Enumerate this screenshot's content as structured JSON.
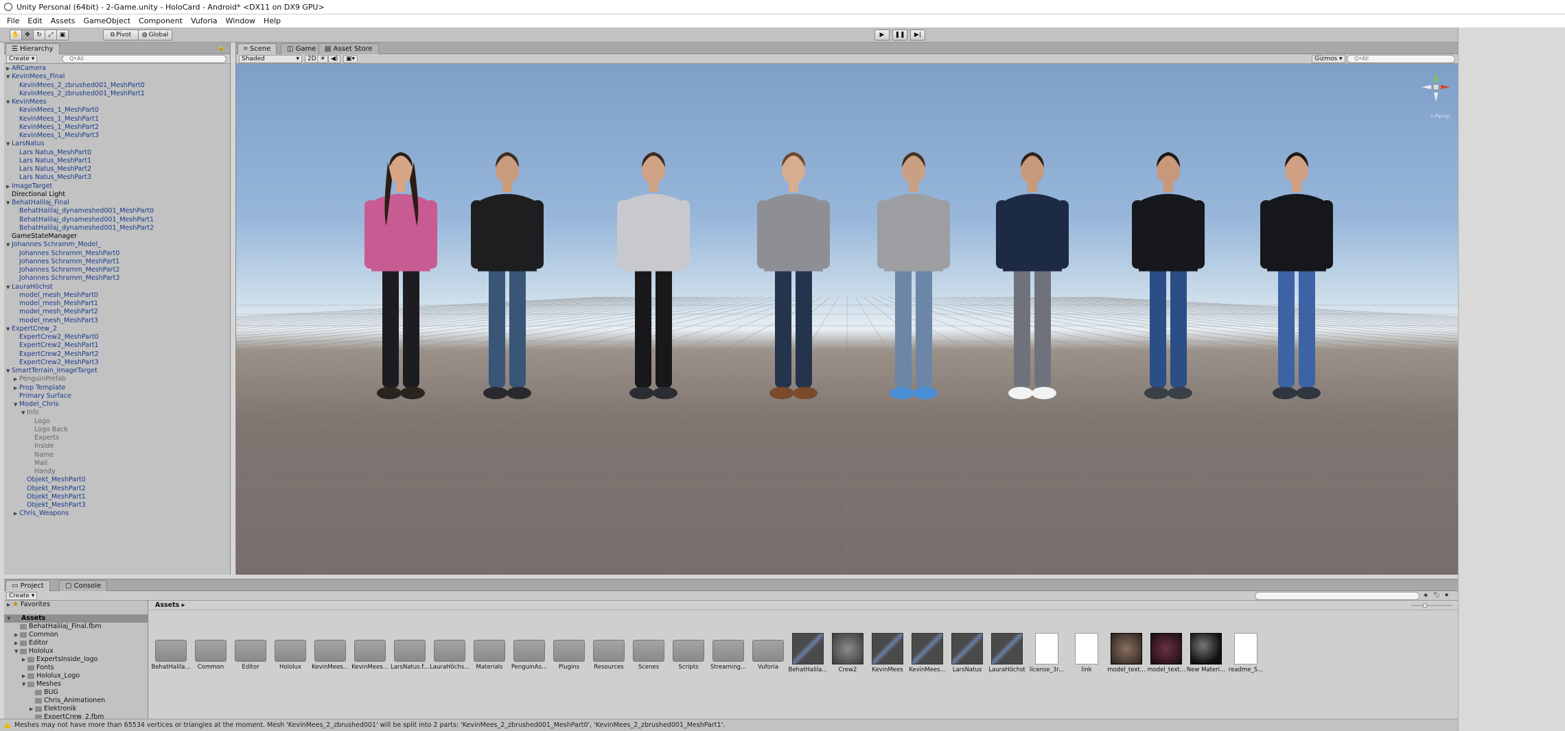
{
  "window": {
    "title": "Unity Personal (64bit) - 2-Game.unity - HoloCard - Android* <DX11 on DX9 GPU>"
  },
  "menu": [
    "File",
    "Edit",
    "Assets",
    "GameObject",
    "Component",
    "Vuforia",
    "Window",
    "Help"
  ],
  "toolbar": {
    "pivot_label": "Pivot",
    "global_label": "Global"
  },
  "hierarchy": {
    "tab_label": "Hierarchy",
    "create_label": "Create",
    "search_placeholder": "Q•All",
    "items": [
      {
        "label": "ARCamera",
        "depth": 0,
        "arrow": "right",
        "style": "blue"
      },
      {
        "label": "KevinMees_Final",
        "depth": 0,
        "arrow": "down",
        "style": "blue"
      },
      {
        "label": "KevinMees_2_zbrushed001_MeshPart0",
        "depth": 1,
        "arrow": "",
        "style": "blue"
      },
      {
        "label": "KevinMees_2_zbrushed001_MeshPart1",
        "depth": 1,
        "arrow": "",
        "style": "blue"
      },
      {
        "label": "KevinMees",
        "depth": 0,
        "arrow": "down",
        "style": "blue"
      },
      {
        "label": "KevinMees_1_MeshPart0",
        "depth": 1,
        "arrow": "",
        "style": "blue"
      },
      {
        "label": "KevinMees_1_MeshPart1",
        "depth": 1,
        "arrow": "",
        "style": "blue"
      },
      {
        "label": "KevinMees_1_MeshPart2",
        "depth": 1,
        "arrow": "",
        "style": "blue"
      },
      {
        "label": "KevinMees_1_MeshPart3",
        "depth": 1,
        "arrow": "",
        "style": "blue"
      },
      {
        "label": "LarsNatus",
        "depth": 0,
        "arrow": "down",
        "style": "blue"
      },
      {
        "label": "Lars Natus_MeshPart0",
        "depth": 1,
        "arrow": "",
        "style": "blue"
      },
      {
        "label": "Lars Natus_MeshPart1",
        "depth": 1,
        "arrow": "",
        "style": "blue"
      },
      {
        "label": "Lars Natus_MeshPart2",
        "depth": 1,
        "arrow": "",
        "style": "blue"
      },
      {
        "label": "Lars Natus_MeshPart3",
        "depth": 1,
        "arrow": "",
        "style": "blue"
      },
      {
        "label": "ImageTarget",
        "depth": 0,
        "arrow": "right",
        "style": "blue"
      },
      {
        "label": "Directional Light",
        "depth": 0,
        "arrow": "",
        "style": "dark"
      },
      {
        "label": "BehatHalilaj_Final",
        "depth": 0,
        "arrow": "down",
        "style": "blue"
      },
      {
        "label": "BehatHalilaj_dynameshed001_MeshPart0",
        "depth": 1,
        "arrow": "",
        "style": "blue"
      },
      {
        "label": "BehatHalilaj_dynameshed001_MeshPart1",
        "depth": 1,
        "arrow": "",
        "style": "blue"
      },
      {
        "label": "BehatHalilaj_dynameshed001_MeshPart2",
        "depth": 1,
        "arrow": "",
        "style": "blue"
      },
      {
        "label": "GameStateManager",
        "depth": 0,
        "arrow": "",
        "style": "dark"
      },
      {
        "label": "Johannes Schramm_Model_",
        "depth": 0,
        "arrow": "down",
        "style": "blue"
      },
      {
        "label": "Johannes Schramm_MeshPart0",
        "depth": 1,
        "arrow": "",
        "style": "blue"
      },
      {
        "label": "Johannes Schramm_MeshPart1",
        "depth": 1,
        "arrow": "",
        "style": "blue"
      },
      {
        "label": "Johannes Schramm_MeshPart2",
        "depth": 1,
        "arrow": "",
        "style": "blue"
      },
      {
        "label": "Johannes Schramm_MeshPart3",
        "depth": 1,
        "arrow": "",
        "style": "blue"
      },
      {
        "label": "LauraHöchst",
        "depth": 0,
        "arrow": "down",
        "style": "blue"
      },
      {
        "label": "model_mesh_MeshPart0",
        "depth": 1,
        "arrow": "",
        "style": "blue"
      },
      {
        "label": "model_mesh_MeshPart1",
        "depth": 1,
        "arrow": "",
        "style": "blue"
      },
      {
        "label": "model_mesh_MeshPart2",
        "depth": 1,
        "arrow": "",
        "style": "blue"
      },
      {
        "label": "model_mesh_MeshPart3",
        "depth": 1,
        "arrow": "",
        "style": "blue"
      },
      {
        "label": "ExpertCrew_2",
        "depth": 0,
        "arrow": "down",
        "style": "blue"
      },
      {
        "label": "ExpertCrew2_MeshPart0",
        "depth": 1,
        "arrow": "",
        "style": "blue"
      },
      {
        "label": "ExpertCrew2_MeshPart1",
        "depth": 1,
        "arrow": "",
        "style": "blue"
      },
      {
        "label": "ExpertCrew2_MeshPart2",
        "depth": 1,
        "arrow": "",
        "style": "blue"
      },
      {
        "label": "ExpertCrew2_MeshPart3",
        "depth": 1,
        "arrow": "",
        "style": "blue"
      },
      {
        "label": "SmartTerrain_ImageTarget",
        "depth": 0,
        "arrow": "down",
        "style": "blue"
      },
      {
        "label": "PenguinPrefab",
        "depth": 1,
        "arrow": "right",
        "style": "gray"
      },
      {
        "label": "Prop Template",
        "depth": 1,
        "arrow": "right",
        "style": "blue"
      },
      {
        "label": "Primary Surface",
        "depth": 1,
        "arrow": "",
        "style": "blue"
      },
      {
        "label": "Model_Chris",
        "depth": 1,
        "arrow": "down",
        "style": "blue"
      },
      {
        "label": "Info",
        "depth": 2,
        "arrow": "down",
        "style": "gray"
      },
      {
        "label": "Logo",
        "depth": 3,
        "arrow": "",
        "style": "gray"
      },
      {
        "label": "Logo Back",
        "depth": 3,
        "arrow": "",
        "style": "gray"
      },
      {
        "label": "Experts",
        "depth": 3,
        "arrow": "",
        "style": "gray"
      },
      {
        "label": "Inside",
        "depth": 3,
        "arrow": "",
        "style": "gray"
      },
      {
        "label": "Name",
        "depth": 3,
        "arrow": "",
        "style": "gray"
      },
      {
        "label": "Mail",
        "depth": 3,
        "arrow": "",
        "style": "gray"
      },
      {
        "label": "Handy",
        "depth": 3,
        "arrow": "",
        "style": "gray"
      },
      {
        "label": "Objekt_MeshPart0",
        "depth": 2,
        "arrow": "",
        "style": "blue"
      },
      {
        "label": "Objekt_MeshPart2",
        "depth": 2,
        "arrow": "",
        "style": "blue"
      },
      {
        "label": "Objekt_MeshPart1",
        "depth": 2,
        "arrow": "",
        "style": "blue"
      },
      {
        "label": "Objekt_MeshPart3",
        "depth": 2,
        "arrow": "",
        "style": "blue"
      },
      {
        "label": "Chris_Weapons",
        "depth": 1,
        "arrow": "right",
        "style": "blue"
      }
    ]
  },
  "scene": {
    "tabs": [
      "Scene",
      "Game",
      "Asset Store"
    ],
    "shading_label": "Shaded",
    "mode_2d_label": "2D",
    "gizmos_label": "Gizmos",
    "search_placeholder": "Q•All",
    "persp_label": "←Persp",
    "people": [
      {
        "top": "#c95b93",
        "bottom": "#1d1c20",
        "skin": "#d8a486",
        "hair": "#2b1d16",
        "shoes": "#2a2420"
      },
      {
        "top": "#1e1e20",
        "bottom": "#3a5677",
        "skin": "#c99b7d",
        "hair": "#3a2d24",
        "shoes": "#2a2a2e"
      },
      {
        "top": "#c8c9ce",
        "bottom": "#18181b",
        "skin": "#d0a286",
        "hair": "#3d2b1e",
        "shoes": "#2b2d33"
      },
      {
        "top": "#8d8f95",
        "bottom": "#25344d",
        "skin": "#d7ad8f",
        "hair": "#6b4a2d",
        "shoes": "#7a4a2a"
      },
      {
        "top": "#9c9ea1",
        "bottom": "#6b86a7",
        "skin": "#caa084",
        "hair": "#4a3221",
        "shoes": "#4a8ed6"
      },
      {
        "top": "#1d2a44",
        "bottom": "#6f727a",
        "skin": "#c69a7a",
        "hair": "#2e231c",
        "shoes": "#f2f2f2"
      },
      {
        "top": "#17181d",
        "bottom": "#2a4e85",
        "skin": "#c8987b",
        "hair": "#1e1712",
        "shoes": "#3a3f48"
      },
      {
        "top": "#16171b",
        "bottom": "#3e63a4",
        "skin": "#cfa083",
        "hair": "#231913",
        "shoes": "#303640"
      }
    ]
  },
  "project": {
    "tabs": [
      "Project",
      "Console"
    ],
    "create_label": "Create",
    "tree": [
      {
        "label": "Favorites",
        "depth": 0,
        "arrow": "right",
        "icon": "star",
        "selected": false
      },
      {
        "label": "Assets",
        "depth": 0,
        "arrow": "down",
        "icon": "folder",
        "selected": true
      },
      {
        "label": "BehatHalilaj_Final.fbm",
        "depth": 1,
        "arrow": "",
        "icon": "folder",
        "selected": false
      },
      {
        "label": "Common",
        "depth": 1,
        "arrow": "right",
        "icon": "folder",
        "selected": false
      },
      {
        "label": "Editor",
        "depth": 1,
        "arrow": "right",
        "icon": "folder",
        "selected": false
      },
      {
        "label": "Hololux",
        "depth": 1,
        "arrow": "down",
        "icon": "folder",
        "selected": false
      },
      {
        "label": "ExpertsInside_logo",
        "depth": 2,
        "arrow": "right",
        "icon": "folder",
        "selected": false
      },
      {
        "label": "Fonts",
        "depth": 2,
        "arrow": "",
        "icon": "folder",
        "selected": false
      },
      {
        "label": "Hololux_Logo",
        "depth": 2,
        "arrow": "right",
        "icon": "folder",
        "selected": false
      },
      {
        "label": "Meshes",
        "depth": 2,
        "arrow": "down",
        "icon": "folder",
        "selected": false
      },
      {
        "label": "BUG",
        "depth": 3,
        "arrow": "",
        "icon": "folder",
        "selected": false
      },
      {
        "label": "Chris_Animationen",
        "depth": 3,
        "arrow": "",
        "icon": "folder",
        "selected": false
      },
      {
        "label": "Elektronik",
        "depth": 3,
        "arrow": "right",
        "icon": "folder",
        "selected": false
      },
      {
        "label": "ExpertCrew_2.fbm",
        "depth": 3,
        "arrow": "",
        "icon": "folder",
        "selected": false
      }
    ],
    "breadcrumb": "Assets ▸",
    "assets": [
      {
        "label": "BehatHalila...",
        "kind": "folder"
      },
      {
        "label": "Common",
        "kind": "folder"
      },
      {
        "label": "Editor",
        "kind": "folder"
      },
      {
        "label": "Hololux",
        "kind": "folder"
      },
      {
        "label": "KevinMees...",
        "kind": "folder"
      },
      {
        "label": "KevinMees...",
        "kind": "folder"
      },
      {
        "label": "LarsNatus.f...",
        "kind": "folder"
      },
      {
        "label": "LauraHöchs...",
        "kind": "folder"
      },
      {
        "label": "Materials",
        "kind": "folder"
      },
      {
        "label": "PenguinAs...",
        "kind": "folder"
      },
      {
        "label": "Plugins",
        "kind": "folder"
      },
      {
        "label": "Resources",
        "kind": "folder"
      },
      {
        "label": "Scenes",
        "kind": "folder"
      },
      {
        "label": "Scripts",
        "kind": "folder"
      },
      {
        "label": "Streaming...",
        "kind": "folder"
      },
      {
        "label": "Vuforia",
        "kind": "folder"
      },
      {
        "label": "BehatHalila...",
        "kind": "model"
      },
      {
        "label": "Crew2",
        "kind": "model"
      },
      {
        "label": "KevinMees",
        "kind": "model"
      },
      {
        "label": "KevinMees...",
        "kind": "model"
      },
      {
        "label": "LarsNatus",
        "kind": "model"
      },
      {
        "label": "LauraHöchst",
        "kind": "model"
      },
      {
        "label": "license_3r...",
        "kind": "doc"
      },
      {
        "label": "link",
        "kind": "doc"
      },
      {
        "label": "model_text...",
        "kind": "texture"
      },
      {
        "label": "model_text...",
        "kind": "texture"
      },
      {
        "label": "New Materi...",
        "kind": "material"
      },
      {
        "label": "readme_S...",
        "kind": "doc"
      }
    ]
  },
  "status": {
    "message": "Meshes may not have more than 65534 vertices or triangles at the moment. Mesh 'KevinMees_2_zbrushed001' will be split into 2 parts: 'KevinMees_2_zbrushed001_MeshPart0', 'KevinMees_2_zbrushed001_MeshPart1'."
  }
}
